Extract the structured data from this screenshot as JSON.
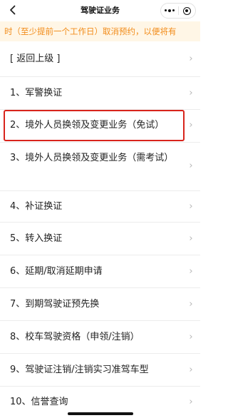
{
  "navbar": {
    "title": "驾驶证业务",
    "back_icon": "chevron-left-icon",
    "more_icon": "more-dots-icon",
    "close_icon": "mini-program-close-icon"
  },
  "notice": {
    "text": "时（至少提前一个工作日）取消预约，以便将有"
  },
  "menu": {
    "items": [
      {
        "label": "[ 返回上级 ]"
      },
      {
        "label": "1、军警换证"
      },
      {
        "label": "2、境外人员换领及变更业务（免试）"
      },
      {
        "label": "3、境外人员换领及变更业务（需考试）"
      },
      {
        "label": "4、补证换证"
      },
      {
        "label": "5、转入换证"
      },
      {
        "label": "6、延期/取消延期申请"
      },
      {
        "label": "7、到期驾驶证预先换"
      },
      {
        "label": "8、校车驾驶资格（申领/注销）"
      },
      {
        "label": "9、驾驶证注销/注销实习准驾车型"
      },
      {
        "label": "10、信誉查询"
      }
    ],
    "chevron_icon": "chevron-right-icon"
  },
  "colors": {
    "notice_text": "#f28c1a",
    "notice_bg": "#fff6e6",
    "highlight_border": "#d8241c"
  }
}
